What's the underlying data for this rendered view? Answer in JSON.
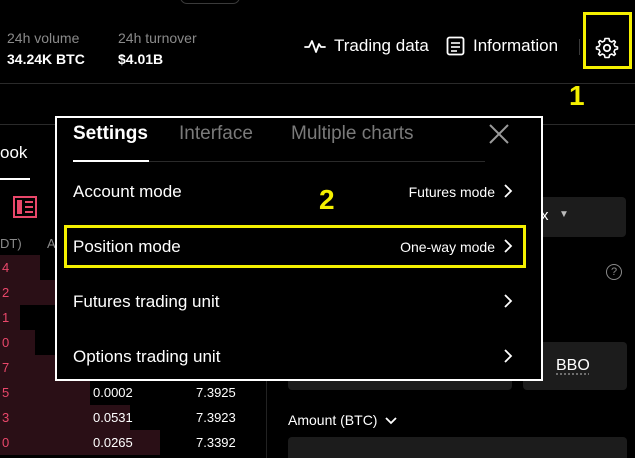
{
  "header": {
    "volume_label": "24h volume",
    "volume_value": "34.24K BTC",
    "turnover_label": "24h turnover",
    "turnover_value": "$4.01B",
    "trading_data": "Trading data",
    "information": "Information"
  },
  "orderbook": {
    "tab_label": "ook",
    "col_unit": "DT)",
    "col_amount": "A",
    "rows": [
      {
        "p": "4",
        "a": "",
        "t": ""
      },
      {
        "p": "2",
        "a": "",
        "t": ""
      },
      {
        "p": "1",
        "a": "",
        "t": ""
      },
      {
        "p": "0",
        "a": "",
        "t": ""
      },
      {
        "p": "7",
        "a": "",
        "t": ""
      },
      {
        "p": "5",
        "a": "0.0002",
        "t": "7.3925"
      },
      {
        "p": "3",
        "a": "0.0531",
        "t": "7.3923"
      },
      {
        "p": "0",
        "a": "0.0265",
        "t": "7.3392"
      }
    ]
  },
  "order_form": {
    "dropdown_value": "x",
    "help_symbol": "?",
    "bbo_label": "BBO",
    "amount_label": "Amount (BTC)"
  },
  "settings_modal": {
    "tabs": [
      "Settings",
      "Interface",
      "Multiple charts"
    ],
    "rows": [
      {
        "label": "Account mode",
        "value": "Futures mode"
      },
      {
        "label": "Position mode",
        "value": "One-way mode"
      },
      {
        "label": "Futures trading unit",
        "value": ""
      },
      {
        "label": "Options trading unit",
        "value": ""
      }
    ]
  },
  "annotations": {
    "step1": "1",
    "step2": "2"
  },
  "colors": {
    "highlight": "#f5f000",
    "ask_red": "#e9476a",
    "background": "#000000"
  }
}
